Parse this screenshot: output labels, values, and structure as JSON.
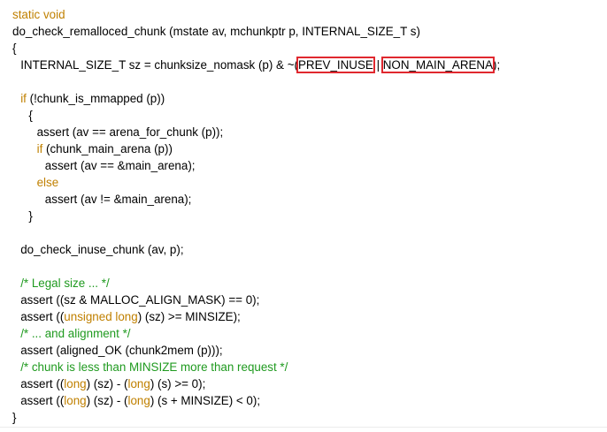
{
  "code": {
    "lines": [
      {
        "indent": 0,
        "tokens": [
          {
            "t": "static void",
            "c": "kw"
          }
        ]
      },
      {
        "indent": 0,
        "tokens": [
          {
            "t": "do_check_remalloced_chunk (mstate av, mchunkptr p, INTERNAL_SIZE_T s)",
            "c": ""
          }
        ]
      },
      {
        "indent": 0,
        "tokens": [
          {
            "t": "{",
            "c": ""
          }
        ]
      },
      {
        "indent": 2,
        "tokens": [
          {
            "t": "INTERNAL_SIZE_T sz = chunksize_nomask (p) & ~(",
            "c": ""
          },
          {
            "t": "PREV_INUSE",
            "c": "hl"
          },
          {
            "t": " | ",
            "c": ""
          },
          {
            "t": "NON_MAIN_ARENA",
            "c": "hl"
          },
          {
            "t": ");",
            "c": ""
          }
        ]
      },
      {
        "indent": 0,
        "tokens": []
      },
      {
        "indent": 2,
        "tokens": [
          {
            "t": "if",
            "c": "kw"
          },
          {
            "t": " (!chunk_is_mmapped (p))",
            "c": ""
          }
        ]
      },
      {
        "indent": 4,
        "tokens": [
          {
            "t": "{",
            "c": ""
          }
        ]
      },
      {
        "indent": 6,
        "tokens": [
          {
            "t": "assert (av == arena_for_chunk (p));",
            "c": ""
          }
        ]
      },
      {
        "indent": 6,
        "tokens": [
          {
            "t": "if",
            "c": "kw"
          },
          {
            "t": " (chunk_main_arena (p))",
            "c": ""
          }
        ]
      },
      {
        "indent": 8,
        "tokens": [
          {
            "t": "assert (av == &main_arena);",
            "c": ""
          }
        ]
      },
      {
        "indent": 6,
        "tokens": [
          {
            "t": "else",
            "c": "kw"
          }
        ]
      },
      {
        "indent": 8,
        "tokens": [
          {
            "t": "assert (av != &main_arena);",
            "c": ""
          }
        ]
      },
      {
        "indent": 4,
        "tokens": [
          {
            "t": "}",
            "c": ""
          }
        ]
      },
      {
        "indent": 0,
        "tokens": []
      },
      {
        "indent": 2,
        "tokens": [
          {
            "t": "do_check_inuse_chunk (av, p);",
            "c": ""
          }
        ]
      },
      {
        "indent": 0,
        "tokens": []
      },
      {
        "indent": 2,
        "tokens": [
          {
            "t": "/* Legal size ... */",
            "c": "cm"
          }
        ]
      },
      {
        "indent": 2,
        "tokens": [
          {
            "t": "assert ((sz & MALLOC_ALIGN_MASK) == 0);",
            "c": ""
          }
        ]
      },
      {
        "indent": 2,
        "tokens": [
          {
            "t": "assert ((",
            "c": ""
          },
          {
            "t": "unsigned long",
            "c": "kw"
          },
          {
            "t": ") (sz) >= MINSIZE);",
            "c": ""
          }
        ]
      },
      {
        "indent": 2,
        "tokens": [
          {
            "t": "/* ... and alignment */",
            "c": "cm"
          }
        ]
      },
      {
        "indent": 2,
        "tokens": [
          {
            "t": "assert (aligned_OK (chunk2mem (p)));",
            "c": ""
          }
        ]
      },
      {
        "indent": 2,
        "tokens": [
          {
            "t": "/* chunk is less than MINSIZE more than request */",
            "c": "cm"
          }
        ]
      },
      {
        "indent": 2,
        "tokens": [
          {
            "t": "assert ((",
            "c": ""
          },
          {
            "t": "long",
            "c": "kw"
          },
          {
            "t": ") (sz) - (",
            "c": ""
          },
          {
            "t": "long",
            "c": "kw"
          },
          {
            "t": ") (s) >= 0);",
            "c": ""
          }
        ]
      },
      {
        "indent": 2,
        "tokens": [
          {
            "t": "assert ((",
            "c": ""
          },
          {
            "t": "long",
            "c": "kw"
          },
          {
            "t": ") (sz) - (",
            "c": ""
          },
          {
            "t": "long",
            "c": "kw"
          },
          {
            "t": ") (s + MINSIZE) < 0);",
            "c": ""
          }
        ]
      },
      {
        "indent": 0,
        "tokens": [
          {
            "t": "}",
            "c": ""
          }
        ]
      }
    ]
  },
  "colors": {
    "keyword": "#c08000",
    "comment": "#1f9a1f",
    "text": "#000000",
    "highlight_box": "#e0282f"
  }
}
